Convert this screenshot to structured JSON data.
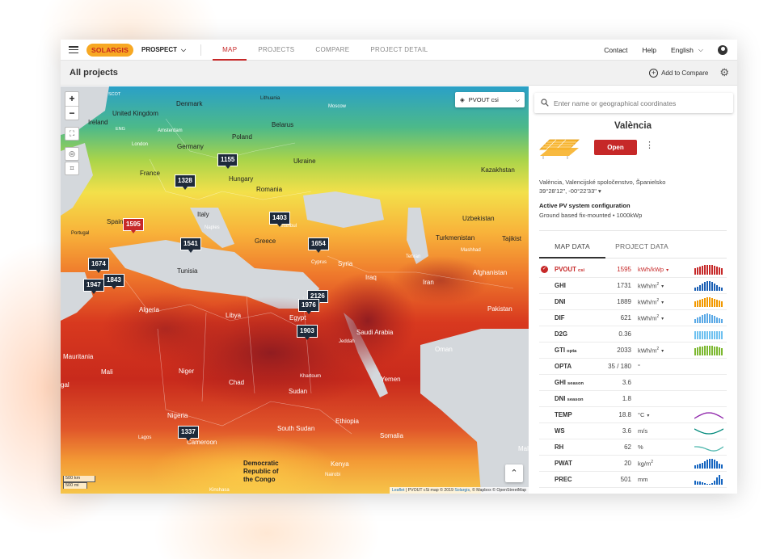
{
  "brand": {
    "logo": "SOLARGIS",
    "product": "PROSPECT",
    "accent": "#c62828",
    "logo_bg": "#f7a823"
  },
  "nav": {
    "tabs": [
      "MAP",
      "PROJECTS",
      "COMPARE",
      "PROJECT DETAIL"
    ],
    "active_tab": "MAP",
    "contact": "Contact",
    "help": "Help",
    "language": "English"
  },
  "header": {
    "title": "All projects",
    "add_to_compare": "Add to Compare"
  },
  "map": {
    "layer_select": "PVOUT csi",
    "zoom_in": "+",
    "zoom_out": "−",
    "scale_km": "500 km",
    "scale_mi": "500 mi",
    "attribution": {
      "leaflet": "Leaflet",
      "text1": " | PVOUT cSi map © 2019 ",
      "solargis": "Solargis",
      "text2": ", © Mapbox © OpenStreetMap"
    },
    "markers": [
      "1155",
      "1328",
      "1595",
      "1403",
      "1541",
      "1654",
      "1674",
      "1947",
      "1843",
      "2126",
      "1976",
      "1903",
      "1337"
    ],
    "selected_marker": "1595",
    "labels": {
      "denmark": "Denmark",
      "uk": "United Kingdom",
      "ireland": "Ireland",
      "poland": "Poland",
      "belarus": "Belarus",
      "germany": "Germany",
      "ukraine": "Ukraine",
      "france": "France",
      "hungary": "Hungary",
      "romania": "Romania",
      "kazakhstan": "Kazakhstan",
      "italy": "Italy",
      "spain": "Spain",
      "portugal": "Portugal",
      "greece": "Greece",
      "turkey": "Turkey",
      "uzbekistan": "Uzbekistan",
      "turkmenistan": "Turkmenistan",
      "tajikistan": "Tajikist",
      "tunisia": "Tunisia",
      "syria": "Syria",
      "iraq": "Iraq",
      "iran": "Iran",
      "afghanistan": "Afghanistan",
      "algeria": "Algeria",
      "libya": "Libya",
      "egypt": "Egypt",
      "saudi": "Saudi Arabia",
      "pakistan": "Pakistan",
      "oman": "Oman",
      "mauritania": "Mauritania",
      "mali": "Mali",
      "niger": "Niger",
      "chad": "Chad",
      "sudan": "Sudan",
      "yemen": "Yemen",
      "nigeria": "Nigeria",
      "ethiopia": "Ethiopia",
      "south_sudan": "South Sudan",
      "somalia": "Somalia",
      "cameroon": "Cameroon",
      "drc1": "Democratic",
      "drc2": "Republic of",
      "drc3": "the Congo",
      "kenya": "Kenya",
      "gal": "gal",
      "mal": "Mal",
      "moscow": "Moscow",
      "istanbul": "Istanbul",
      "amsterdam": "Amsterdam",
      "london": "London",
      "naples": "Naples",
      "cyprus": "Cyprus",
      "jeddah": "Jeddah",
      "khartoum": "Khartoum",
      "tehran": "Tehran",
      "mashhad": "Mashhad",
      "lagos": "Lagos",
      "kinshasa": "Kinshasa",
      "nairobi": "Nairobi",
      "scot": "SCOT",
      "ire": "IRE",
      "eng": "ENG",
      "latvia": "Latvia",
      "lithuania": "Lithuania"
    }
  },
  "panel": {
    "search_placeholder": "Enter name or geographical coordinates",
    "site_name": "València",
    "open_button": "Open",
    "address": "València, Valencijské spoločenstvo, Španielsko",
    "coordinates": "39°28'12\", -00°22'33\"",
    "config_title": "Active PV system configuration",
    "config_text": "Ground based fix-mounted • 1000kWp",
    "tabs": [
      "MAP DATA",
      "PROJECT DATA"
    ],
    "rows": [
      {
        "name": "PVOUT",
        "sub": "csi",
        "value": "1595",
        "unit": "kWh/kWp",
        "sup": "",
        "dd": "▾",
        "spark": "bars",
        "color": "#c62828",
        "sel": true
      },
      {
        "name": "GHI",
        "sub": "",
        "value": "1731",
        "unit": "kWh/m",
        "sup": "2",
        "dd": "▾",
        "spark": "bars",
        "color": "#1a5fb4",
        "sel": false
      },
      {
        "name": "DNI",
        "sub": "",
        "value": "1889",
        "unit": "kWh/m",
        "sup": "2",
        "dd": "▾",
        "spark": "bars",
        "color": "#f29900",
        "sel": false
      },
      {
        "name": "DIF",
        "sub": "",
        "value": "621",
        "unit": "kWh/m",
        "sup": "2",
        "dd": "▾",
        "spark": "bars",
        "color": "#5aa9e6",
        "sel": false
      },
      {
        "name": "D2G",
        "sub": "",
        "value": "0.36",
        "unit": "",
        "sup": "",
        "dd": "",
        "spark": "bars",
        "color": "#6ec1f0",
        "sel": false
      },
      {
        "name": "GTI",
        "sub": "opta",
        "value": "2033",
        "unit": "kWh/m",
        "sup": "2",
        "dd": "▾",
        "spark": "bars",
        "color": "#7cb82f",
        "sel": false
      },
      {
        "name": "OPTA",
        "sub": "",
        "value": "35 / 180",
        "unit": "°",
        "sup": "",
        "dd": "",
        "spark": "none",
        "color": "#444",
        "sel": false
      },
      {
        "name": "GHI",
        "sub": "season",
        "value": "3.6",
        "unit": "",
        "sup": "",
        "dd": "",
        "spark": "none",
        "color": "#444",
        "sel": false
      },
      {
        "name": "DNI",
        "sub": "season",
        "value": "1.8",
        "unit": "",
        "sup": "",
        "dd": "",
        "spark": "none",
        "color": "#444",
        "sel": false
      },
      {
        "name": "TEMP",
        "sub": "",
        "value": "18.8",
        "unit": "°C",
        "sup": "",
        "dd": "▾",
        "spark": "wave",
        "color": "#8e24aa",
        "sel": false
      },
      {
        "name": "WS",
        "sub": "",
        "value": "3.6",
        "unit": "m/s",
        "sup": "",
        "dd": "",
        "spark": "wave",
        "color": "#00897b",
        "sel": false
      },
      {
        "name": "RH",
        "sub": "",
        "value": "62",
        "unit": "%",
        "sup": "",
        "dd": "",
        "spark": "wave",
        "color": "#4db6ac",
        "sel": false
      },
      {
        "name": "PWAT",
        "sub": "",
        "value": "20",
        "unit": "kg/m",
        "sup": "2",
        "dd": "",
        "spark": "bars",
        "color": "#1565c0",
        "sel": false
      },
      {
        "name": "PREC",
        "sub": "",
        "value": "501",
        "unit": "mm",
        "sup": "",
        "dd": "",
        "spark": "bars",
        "color": "#1565c0",
        "sel": false
      }
    ]
  }
}
